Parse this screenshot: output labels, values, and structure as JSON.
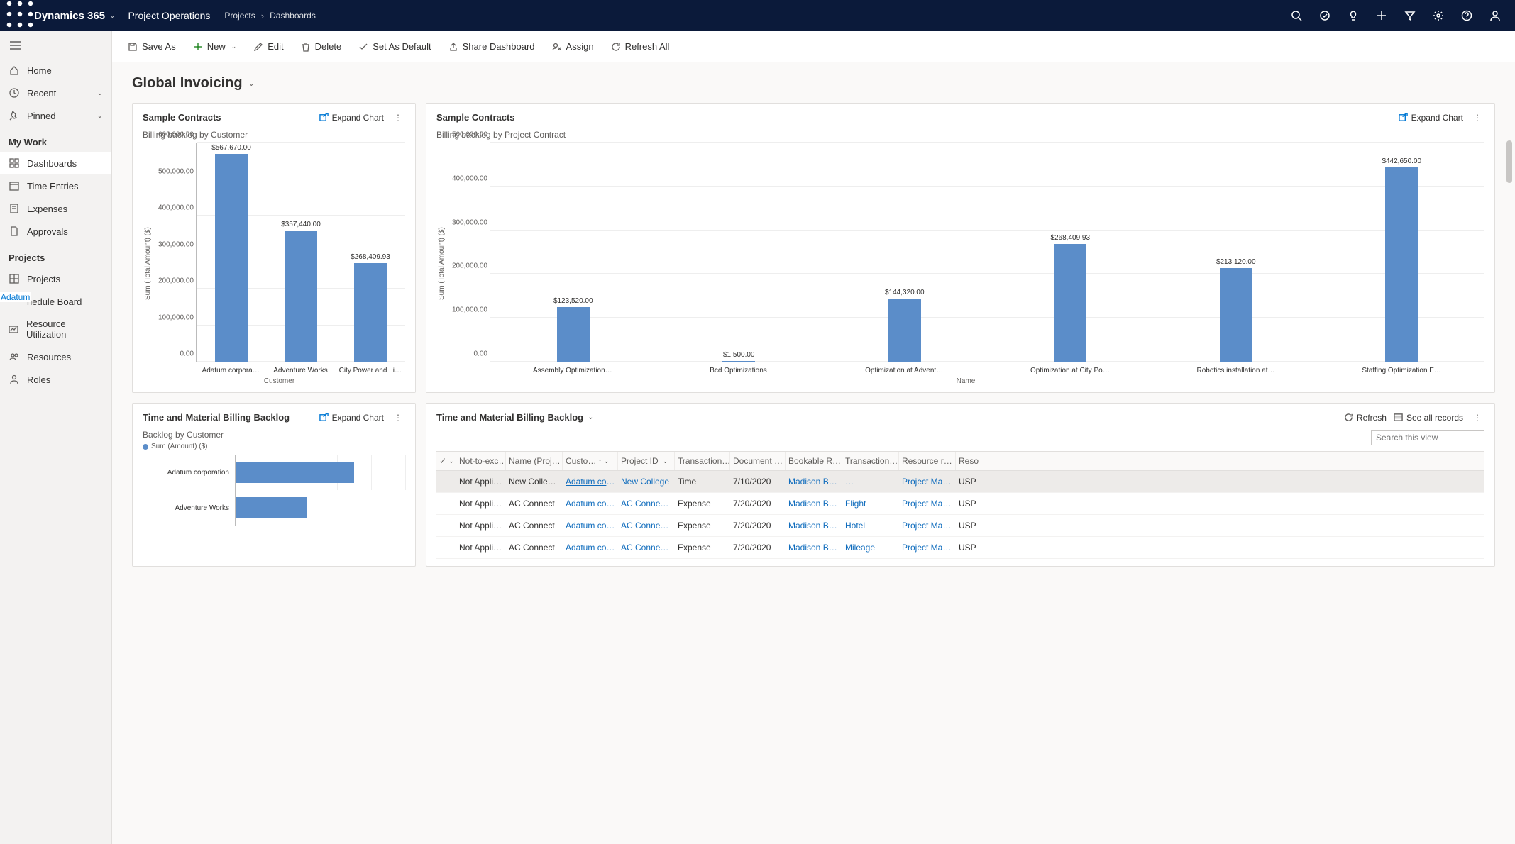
{
  "topbar": {
    "brand": "Dynamics 365",
    "module": "Project Operations",
    "breadcrumb": [
      "Projects",
      "Dashboards"
    ]
  },
  "sidebar": {
    "home": "Home",
    "recent": "Recent",
    "pinned": "Pinned",
    "sections": {
      "mywork": {
        "title": "My Work",
        "items": [
          "Dashboards",
          "Time Entries",
          "Expenses",
          "Approvals"
        ]
      },
      "projects": {
        "title": "Projects",
        "items": [
          "Projects",
          "hedule Board",
          "Resource Utilization",
          "Resources",
          "Roles"
        ]
      }
    },
    "adatum_tag": "Adatum"
  },
  "commands": {
    "saveas": "Save As",
    "new": "New",
    "edit": "Edit",
    "delete": "Delete",
    "setdefault": "Set As Default",
    "share": "Share Dashboard",
    "assign": "Assign",
    "refresh": "Refresh All"
  },
  "page_title": "Global Invoicing",
  "cards": {
    "c1": {
      "title": "Sample Contracts",
      "subtitle": "Billing backlog by Customer",
      "expand": "Expand Chart"
    },
    "c2": {
      "title": "Sample Contracts",
      "subtitle": "Billing backlog by Project Contract",
      "expand": "Expand Chart"
    },
    "c3": {
      "title": "Time and Material Billing Backlog",
      "subtitle": "Backlog by Customer",
      "legend": "Sum (Amount) ($)",
      "expand": "Expand Chart"
    },
    "c4": {
      "title": "Time and Material Billing Backlog",
      "refresh": "Refresh",
      "seeall": "See all records"
    }
  },
  "chart_data": [
    {
      "id": "chart1",
      "type": "bar",
      "title": "Billing backlog by Customer",
      "ylabel": "Sum (Total Amount) ($)",
      "xlabel": "Customer",
      "ylim": [
        0,
        600000
      ],
      "ystep": 100000,
      "categories": [
        "Adatum corpora…",
        "Adventure Works",
        "City Power and Li…"
      ],
      "values": [
        567670.0,
        357440.0,
        268409.93
      ],
      "value_labels": [
        "$567,670.00",
        "$357,440.00",
        "$268,409.93"
      ],
      "ytick_labels": [
        "0.00",
        "100,000.00",
        "200,000.00",
        "300,000.00",
        "400,000.00",
        "500,000.00",
        "600,000.00"
      ]
    },
    {
      "id": "chart2",
      "type": "bar",
      "title": "Billing backlog by Project Contract",
      "ylabel": "Sum (Total Amount) ($)",
      "xlabel": "Name",
      "ylim": [
        0,
        500000
      ],
      "ystep": 100000,
      "categories": [
        "Assembly Optimization…",
        "Bcd Optimizations",
        "Optimization at Advent…",
        "Optimization at City Po…",
        "Robotics installation at…",
        "Staffing Optimization E…"
      ],
      "values": [
        123520.0,
        1500.0,
        144320.0,
        268409.93,
        213120.0,
        442650.0
      ],
      "value_labels": [
        "$123,520.00",
        "$1,500.00",
        "$144,320.00",
        "$268,409.93",
        "$213,120.00",
        "$442,650.00"
      ],
      "ytick_labels": [
        "0.00",
        "100,000.00",
        "200,000.00",
        "300,000.00",
        "400,000.00",
        "500,000.00"
      ]
    },
    {
      "id": "chart3",
      "type": "bar",
      "orientation": "horizontal",
      "title": "Backlog by Customer",
      "series_name": "Sum (Amount) ($)",
      "categories": [
        "Adatum corporation",
        "Adventure Works"
      ],
      "values": [
        100,
        60
      ]
    }
  ],
  "grid": {
    "search_placeholder": "Search this view",
    "columns": [
      "",
      "Not-to-exc…",
      "Name (Proj…",
      "Custo…",
      "Project ID",
      "Transaction…",
      "Document …",
      "Bookable R…",
      "Transaction…",
      "Resource r…",
      "Reso"
    ],
    "sort_up_col": 3,
    "rows": [
      {
        "sel": true,
        "nte": "Not Applic…",
        "name": "New Colle…",
        "cust": "Adatum corpo",
        "pid": "New College",
        "trn": "Time",
        "doc": "7/10/2020",
        "bkr": "Madison Bulter",
        "trn2": "…",
        "rr": "Project Manage",
        "res": "USP"
      },
      {
        "sel": false,
        "nte": "Not Applic…",
        "name": "AC Connect",
        "cust": "Adatum corpo",
        "pid": "AC Connect Pro",
        "trn": "Expense",
        "doc": "7/20/2020",
        "bkr": "Madison Bulter",
        "trn2": "Flight",
        "rr": "Project Manage",
        "res": "USP"
      },
      {
        "sel": false,
        "nte": "Not Applic…",
        "name": "AC Connect",
        "cust": "Adatum corpo",
        "pid": "AC Connect Pro",
        "trn": "Expense",
        "doc": "7/20/2020",
        "bkr": "Madison Bulter",
        "trn2": "Hotel",
        "rr": "Project Manage",
        "res": "USP"
      },
      {
        "sel": false,
        "nte": "Not Applic…",
        "name": "AC Connect",
        "cust": "Adatum corpo",
        "pid": "AC Connect Pro",
        "trn": "Expense",
        "doc": "7/20/2020",
        "bkr": "Madison Bulter",
        "trn2": "Mileage",
        "rr": "Project Manage",
        "res": "USP"
      }
    ]
  }
}
